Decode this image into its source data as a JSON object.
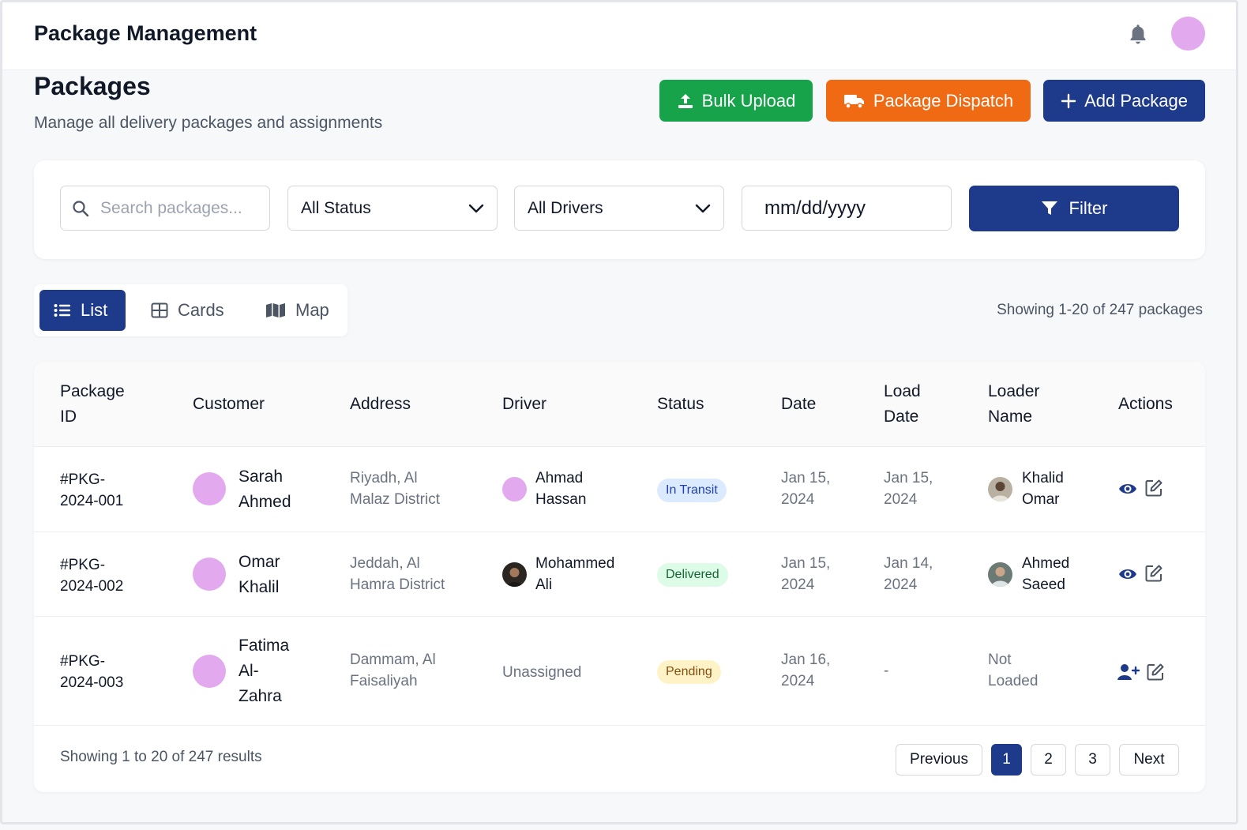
{
  "app": {
    "title": "Package Management"
  },
  "icons": {
    "notifications": "bell-icon",
    "profile": "avatar"
  },
  "colors": {
    "primary": "#1e3a8a",
    "bulk": "#16a34a",
    "dispatch": "#f06a14",
    "avatar": "#e3a9ee"
  },
  "header": {
    "title": "Packages",
    "subtitle": "Manage all delivery packages and assignments",
    "actions": {
      "bulk_upload": "Bulk Upload",
      "package_dispatch": "Package Dispatch",
      "add_package": "Add Package"
    }
  },
  "filters": {
    "search_placeholder": "Search packages...",
    "status": "All Status",
    "drivers": "All Drivers",
    "date_placeholder": "mm/dd/yyyy",
    "filter_label": "Filter"
  },
  "views": {
    "list": "List",
    "cards": "Cards",
    "map": "Map",
    "active": "List"
  },
  "summary": "Showing 1-20 of 247 packages",
  "table": {
    "columns": {
      "package_id": [
        "Package",
        "ID"
      ],
      "customer": "Customer",
      "address": "Address",
      "driver": "Driver",
      "status": "Status",
      "date": "Date",
      "load_date": [
        "Load",
        "Date"
      ],
      "loader_name": [
        "Loader",
        "Name"
      ],
      "actions": "Actions"
    },
    "rows": [
      {
        "id": [
          "#PKG-",
          "2024-001"
        ],
        "customer": [
          "Sarah",
          "Ahmed"
        ],
        "address": [
          "Riyadh, Al",
          "Malaz District"
        ],
        "driver": [
          "Ahmad",
          "Hassan"
        ],
        "status": "In Transit",
        "date": [
          "Jan 15,",
          "2024"
        ],
        "load_date": [
          "Jan 15,",
          "2024"
        ],
        "loader": [
          "Khalid",
          "Omar"
        ]
      },
      {
        "id": [
          "#PKG-",
          "2024-002"
        ],
        "customer": [
          "Omar",
          "Khalil"
        ],
        "address": [
          "Jeddah, Al",
          "Hamra District"
        ],
        "driver": [
          "Mohammed",
          "Ali"
        ],
        "status": "Delivered",
        "date": [
          "Jan 15,",
          "2024"
        ],
        "load_date": [
          "Jan 14,",
          "2024"
        ],
        "loader": [
          "Ahmed",
          "Saeed"
        ]
      },
      {
        "id": [
          "#PKG-",
          "2024-003"
        ],
        "customer": [
          "Fatima",
          "Al-",
          "Zahra"
        ],
        "address": [
          "Dammam, Al",
          "Faisaliyah"
        ],
        "driver": [
          "Unassigned"
        ],
        "status": "Pending",
        "date": [
          "Jan 16,",
          "2024"
        ],
        "load_date": [
          "-"
        ],
        "loader": [
          "Not",
          "Loaded"
        ]
      }
    ]
  },
  "pagination": {
    "summary": "Showing 1 to 20 of 247 results",
    "previous": "Previous",
    "pages": [
      "1",
      "2",
      "3"
    ],
    "current": "1",
    "next": "Next"
  }
}
